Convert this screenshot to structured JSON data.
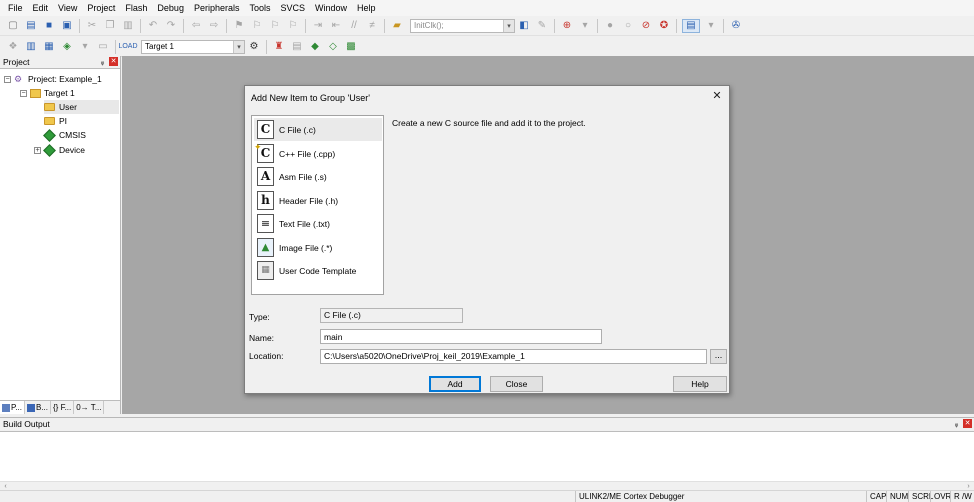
{
  "menu": [
    "File",
    "Edit",
    "View",
    "Project",
    "Flash",
    "Debug",
    "Peripherals",
    "Tools",
    "SVCS",
    "Window",
    "Help"
  ],
  "toolbar": {
    "function_combo": "InitClk();",
    "target_combo": "Target 1"
  },
  "project_panel": {
    "title": "Project",
    "tree": {
      "project": "Project: Example_1",
      "target": "Target 1",
      "groups": [
        "User",
        "PI",
        "CMSIS",
        "Device"
      ]
    },
    "tabs": [
      "P...",
      "B...",
      "{} F...",
      "0→ T..."
    ]
  },
  "build_output": {
    "title": "Build Output"
  },
  "statusbar": {
    "debugger": "ULINK2/ME Cortex Debugger",
    "indicators": [
      "CAP",
      "NUM",
      "SCRL",
      "OVR",
      "R /W"
    ]
  },
  "dialog": {
    "title": "Add New Item to Group 'User'",
    "close_glyph": "✕",
    "item_types": [
      {
        "label": "C File (.c)",
        "glyph": "C"
      },
      {
        "label": "C++ File (.cpp)",
        "glyph": "C"
      },
      {
        "label": "Asm File (.s)",
        "glyph": "A"
      },
      {
        "label": "Header File (.h)",
        "glyph": "h"
      },
      {
        "label": "Text File (.txt)",
        "glyph": "≡"
      },
      {
        "label": "Image File (.*)",
        "glyph": "▲"
      },
      {
        "label": "User Code Template",
        "glyph": "▦"
      }
    ],
    "description": "Create a new C source file and add it to the project.",
    "type_label": "Type:",
    "type_value": "C File (.c)",
    "name_label": "Name:",
    "name_value": "main",
    "location_label": "Location:",
    "location_value": "C:\\Users\\a5020\\OneDrive\\Proj_keil_2019\\Example_1",
    "browse_label": "...",
    "buttons": {
      "add": "Add",
      "close": "Close",
      "help": "Help"
    }
  }
}
